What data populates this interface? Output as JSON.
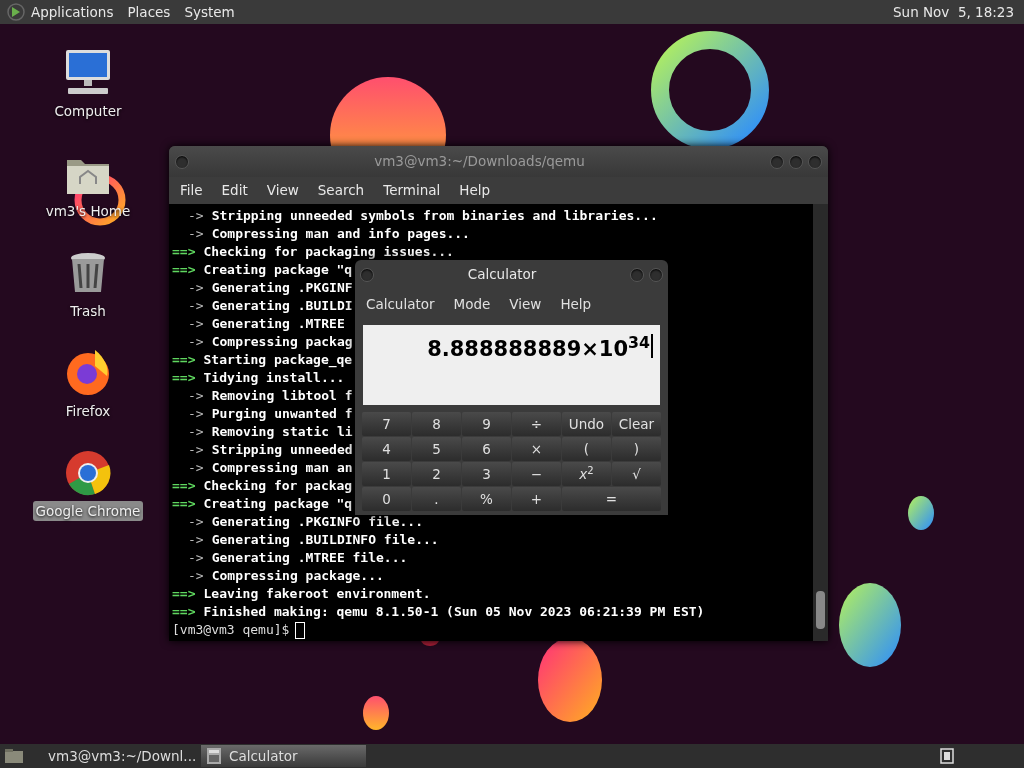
{
  "top_panel": {
    "menus": [
      "Applications",
      "Places",
      "System"
    ],
    "clock": "Sun Nov  5, 18:23"
  },
  "desktop_icons": [
    {
      "kind": "computer",
      "label": "Computer",
      "selected": false
    },
    {
      "kind": "home",
      "label": "vm3's Home",
      "selected": false
    },
    {
      "kind": "trash",
      "label": "Trash",
      "selected": false
    },
    {
      "kind": "firefox",
      "label": "Firefox",
      "selected": false
    },
    {
      "kind": "chrome",
      "label": "Google Chrome",
      "selected": true
    }
  ],
  "terminal": {
    "title": "vm3@vm3:~/Downloads/qemu",
    "menus": [
      "File",
      "Edit",
      "View",
      "Search",
      "Terminal",
      "Help"
    ],
    "lines": [
      {
        "kind": "sub",
        "prefix": "->",
        "text": "Stripping unneeded symbols from binaries and libraries..."
      },
      {
        "kind": "sub",
        "prefix": "->",
        "text": "Compressing man and info pages..."
      },
      {
        "kind": "main",
        "prefix": "==>",
        "text": "Checking for packaging issues..."
      },
      {
        "kind": "main",
        "prefix": "==>",
        "text": "Creating package \"q"
      },
      {
        "kind": "sub",
        "prefix": "->",
        "text": "Generating .PKGINF"
      },
      {
        "kind": "sub",
        "prefix": "->",
        "text": "Generating .BUILDI"
      },
      {
        "kind": "sub",
        "prefix": "->",
        "text": "Generating .MTREE"
      },
      {
        "kind": "sub",
        "prefix": "->",
        "text": "Compressing packag"
      },
      {
        "kind": "main",
        "prefix": "==>",
        "text": "Starting package_qe"
      },
      {
        "kind": "main",
        "prefix": "==>",
        "text": "Tidying install..."
      },
      {
        "kind": "sub",
        "prefix": "->",
        "text": "Removing libtool f"
      },
      {
        "kind": "sub",
        "prefix": "->",
        "text": "Purging unwanted f"
      },
      {
        "kind": "sub",
        "prefix": "->",
        "text": "Removing static li"
      },
      {
        "kind": "sub",
        "prefix": "->",
        "text": "Stripping unneeded"
      },
      {
        "kind": "sub",
        "prefix": "->",
        "text": "Compressing man an"
      },
      {
        "kind": "main",
        "prefix": "==>",
        "text": "Checking for packag"
      },
      {
        "kind": "main",
        "prefix": "==>",
        "text": "Creating package \"q"
      },
      {
        "kind": "sub",
        "prefix": "->",
        "text": "Generating .PKGINFO file..."
      },
      {
        "kind": "sub",
        "prefix": "->",
        "text": "Generating .BUILDINFO file..."
      },
      {
        "kind": "sub",
        "prefix": "->",
        "text": "Generating .MTREE file..."
      },
      {
        "kind": "sub",
        "prefix": "->",
        "text": "Compressing package..."
      },
      {
        "kind": "main",
        "prefix": "==>",
        "text": "Leaving fakeroot environment."
      },
      {
        "kind": "main",
        "prefix": "==>",
        "text": "Finished making: qemu 8.1.50-1 (Sun 05 Nov 2023 06:21:39 PM EST)"
      }
    ],
    "prompt": "[vm3@vm3 qemu]$"
  },
  "calculator": {
    "title": "Calculator",
    "menus": [
      "Calculator",
      "Mode",
      "View",
      "Help"
    ],
    "display": "8.888888889×10$^{34}$",
    "buttons": [
      {
        "label": "7"
      },
      {
        "label": "8"
      },
      {
        "label": "9"
      },
      {
        "label": "÷"
      },
      {
        "label": "Undo"
      },
      {
        "label": "Clear"
      },
      {
        "label": "4"
      },
      {
        "label": "5"
      },
      {
        "label": "6"
      },
      {
        "label": "×"
      },
      {
        "label": "("
      },
      {
        "label": ")"
      },
      {
        "label": "1"
      },
      {
        "label": "2"
      },
      {
        "label": "3"
      },
      {
        "label": "−"
      },
      {
        "label": "*x*$^{2}$"
      },
      {
        "label": "√"
      },
      {
        "label": "0"
      },
      {
        "label": "."
      },
      {
        "label": "%"
      },
      {
        "label": "+"
      },
      {
        "label": "=",
        "kind": "wide"
      }
    ]
  },
  "taskbar": {
    "tasks": [
      {
        "kind": "terminal",
        "label": "vm3@vm3:~/Downl...",
        "selected": false
      },
      {
        "kind": "calculator",
        "label": "Calculator",
        "selected": true
      }
    ]
  }
}
